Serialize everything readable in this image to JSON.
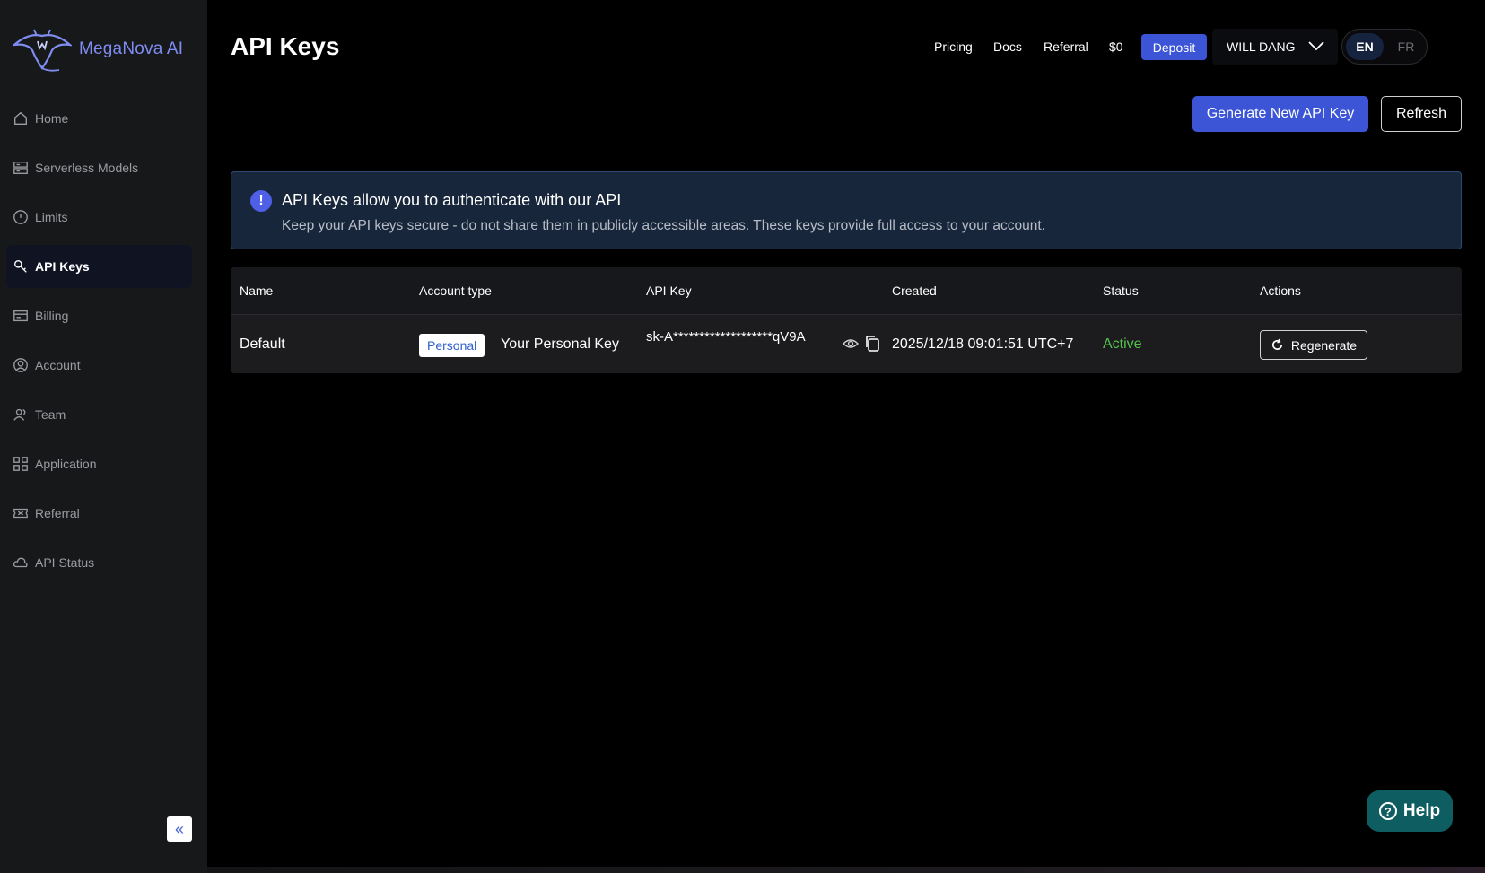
{
  "brand": {
    "name": "MegaNova AI",
    "accent": "#7f8cf0"
  },
  "sidebar": {
    "items": [
      {
        "label": "Home",
        "icon": "home-icon"
      },
      {
        "label": "Serverless Models",
        "icon": "server-icon"
      },
      {
        "label": "Limits",
        "icon": "info-icon"
      },
      {
        "label": "API Keys",
        "icon": "key-icon",
        "active": true
      },
      {
        "label": "Billing",
        "icon": "billing-icon"
      },
      {
        "label": "Account",
        "icon": "account-icon"
      },
      {
        "label": "Team",
        "icon": "team-icon"
      },
      {
        "label": "Application",
        "icon": "grid-icon"
      },
      {
        "label": "Referral",
        "icon": "ticket-icon"
      },
      {
        "label": "API Status",
        "icon": "cloud-icon"
      }
    ],
    "collapse_glyph": "«"
  },
  "header": {
    "title": "API Keys",
    "links": {
      "pricing": "Pricing",
      "docs": "Docs",
      "referral": "Referral",
      "balance": "$0"
    },
    "deposit_label": "Deposit",
    "user_name": "WILL DANG",
    "lang": {
      "en": "EN",
      "fr": "FR",
      "selected": "EN"
    }
  },
  "actions": {
    "generate_label": "Generate New API Key",
    "refresh_label": "Refresh"
  },
  "alert": {
    "icon_glyph": "!",
    "title": "API Keys allow you to authenticate with our API",
    "body": "Keep your API keys secure - do not share them in publicly accessible areas. These keys provide full access to your account."
  },
  "table": {
    "headers": {
      "name": "Name",
      "account_type": "Account type",
      "api_key": "API Key",
      "created": "Created",
      "status": "Status",
      "actions": "Actions"
    },
    "rows": [
      {
        "name": "Default",
        "account_badge": "Personal",
        "account_label": "Your Personal Key",
        "api_key": "sk-A*******************qV9A",
        "created": "2025/12/18 09:01:51 UTC+7",
        "status": "Active",
        "action_label": "Regenerate"
      }
    ]
  },
  "help": {
    "label": "Help",
    "glyph": "?"
  }
}
